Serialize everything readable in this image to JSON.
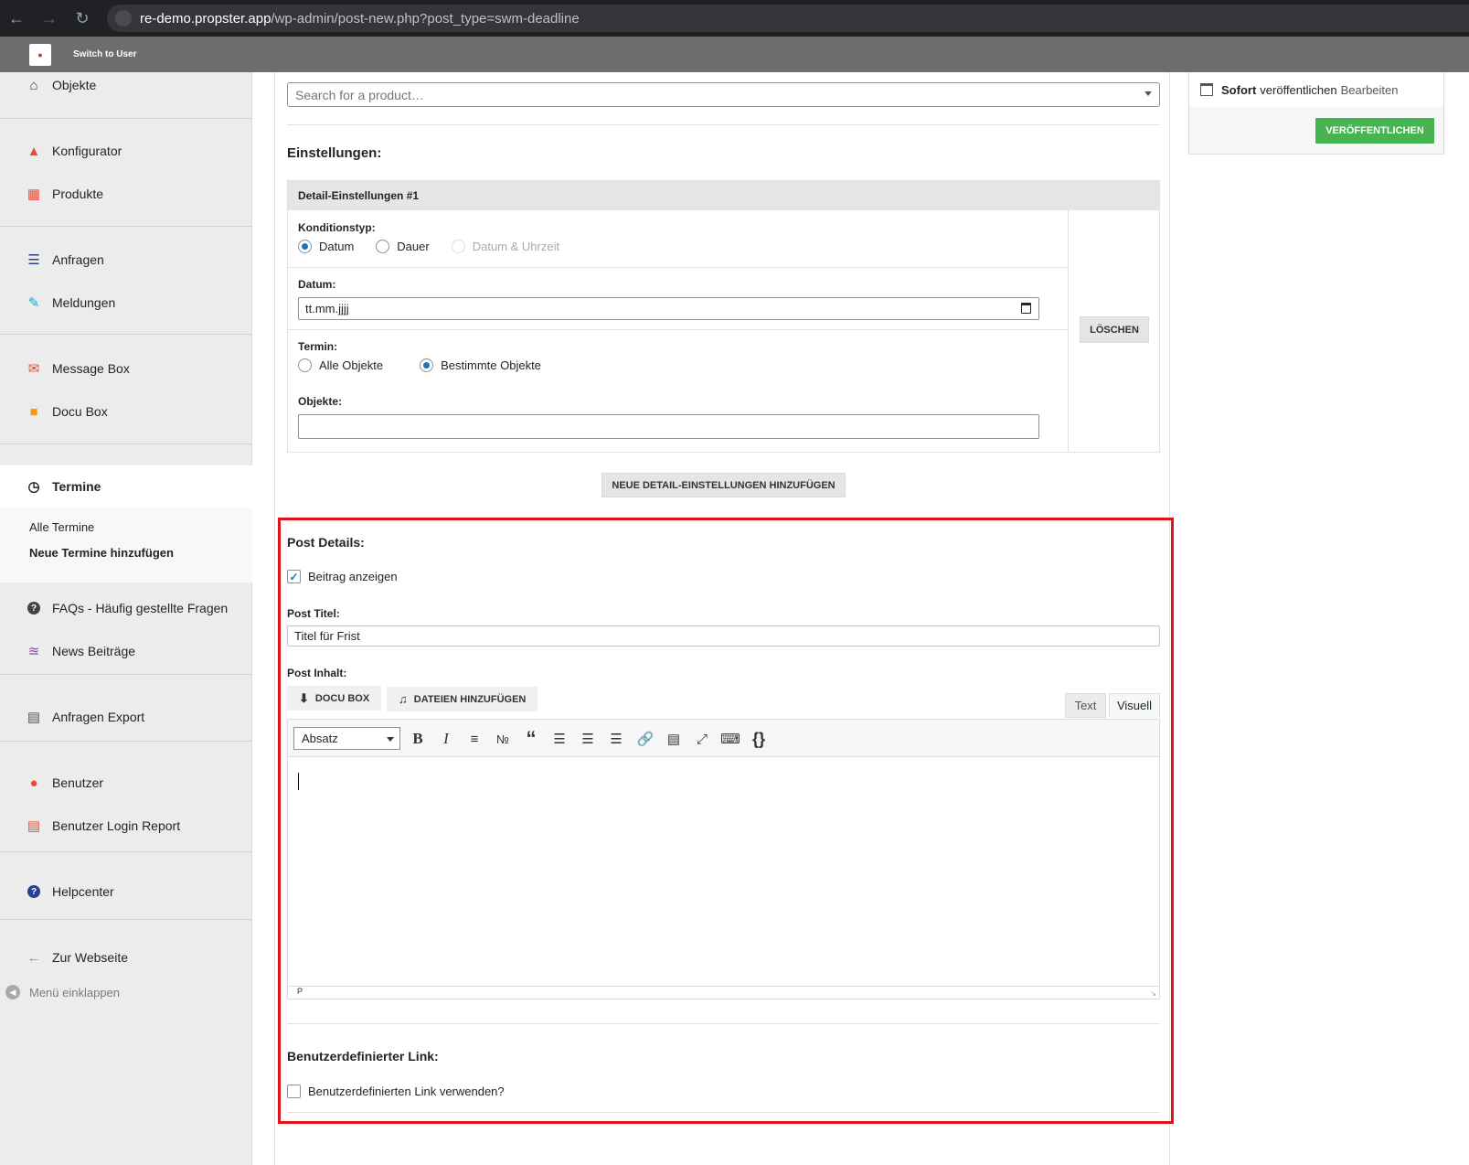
{
  "browser": {
    "url_host": "re-demo.propster.app",
    "url_path": "/wp-admin/post-new.php?post_type=swm-deadline"
  },
  "adminbar": {
    "switch_user": "Switch to User"
  },
  "sidebar": {
    "items": [
      {
        "label": "Objekte"
      },
      {
        "label": "Konfigurator"
      },
      {
        "label": "Produkte"
      },
      {
        "label": "Anfragen"
      },
      {
        "label": "Meldungen"
      },
      {
        "label": "Message Box"
      },
      {
        "label": "Docu Box"
      },
      {
        "label": "Termine"
      },
      {
        "label": "FAQs - Häufig gestellte Fragen"
      },
      {
        "label": "News Beiträge"
      },
      {
        "label": "Anfragen Export"
      },
      {
        "label": "Benutzer"
      },
      {
        "label": "Benutzer Login Report"
      },
      {
        "label": "Helpcenter"
      },
      {
        "label": "Zur Webseite"
      }
    ],
    "submenu": [
      "Alle Termine",
      "Neue Termine hinzufügen"
    ],
    "collapse": "Menü einklappen"
  },
  "main": {
    "search_placeholder": "Search for a product…",
    "settings_title": "Einstellungen:",
    "detail_title": "Detail-Einstellungen #1",
    "konditionstyp_label": "Konditionstyp:",
    "konditionstyp_options": [
      "Datum",
      "Dauer",
      "Datum & Uhrzeit"
    ],
    "datum_label": "Datum:",
    "datum_value": "tt.mm.jjjj",
    "termin_label": "Termin:",
    "termin_options": [
      "Alle Objekte",
      "Bestimmte Objekte"
    ],
    "objekte_label": "Objekte:",
    "delete_button": "LÖSCHEN",
    "add_detail_button": "NEUE DETAIL-EINSTELLUNGEN HINZUFÜGEN",
    "post_details_title": "Post Details:",
    "show_post_label": "Beitrag anzeigen",
    "post_title_label": "Post Titel:",
    "post_title_value": "Titel für Frist",
    "post_content_label": "Post Inhalt:",
    "docu_box_button": "DOCU BOX",
    "add_files_button": "DATEIEN HINZUFÜGEN",
    "tab_text": "Text",
    "tab_visual": "Visuell",
    "format_select": "Absatz",
    "editor_path": "P",
    "custom_link_title": "Benutzerdefinierter Link:",
    "custom_link_label": "Benutzerdefinierten Link verwenden?"
  },
  "publish": {
    "status_bold": "Sofort",
    "status_text": "veröffentlichen",
    "edit_link": "Bearbeiten",
    "publish_button": "VERÖFFENTLICHEN"
  },
  "colors": {
    "highlight": "#e0121c",
    "publish": "#46b450",
    "radio_accent": "#2271b1"
  }
}
